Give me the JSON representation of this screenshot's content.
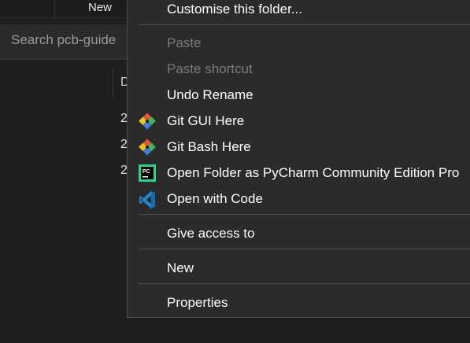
{
  "explorer": {
    "toolbar": {
      "new_label": "New"
    },
    "search": {
      "placeholder": "Search pcb-guide"
    },
    "file_list": {
      "column_header": "D",
      "rows": [
        "2",
        "2",
        "2"
      ]
    }
  },
  "context_menu": {
    "items": [
      {
        "label": "Customise this folder...",
        "enabled": true
      },
      {
        "label": "Paste",
        "enabled": false
      },
      {
        "label": "Paste shortcut",
        "enabled": false
      },
      {
        "label": "Undo Rename",
        "enabled": true
      },
      {
        "label": "Git GUI Here",
        "enabled": true,
        "icon": "git-gui-icon"
      },
      {
        "label": "Git Bash Here",
        "enabled": true,
        "icon": "git-bash-icon"
      },
      {
        "label": "Open Folder as PyCharm Community Edition Pro",
        "enabled": true,
        "icon": "pycharm-icon"
      },
      {
        "label": "Open with Code",
        "enabled": true,
        "icon": "vscode-icon"
      },
      {
        "label": "Give access to",
        "enabled": true
      },
      {
        "label": "New",
        "enabled": true
      },
      {
        "label": "Properties",
        "enabled": true
      }
    ]
  },
  "colors": {
    "menu_background": "#2b2b2b",
    "menu_text": "#ffffff",
    "menu_disabled_text": "#7a7a7a",
    "pycharm_green": "#21d789",
    "vscode_blue": "#1f8ad2"
  }
}
